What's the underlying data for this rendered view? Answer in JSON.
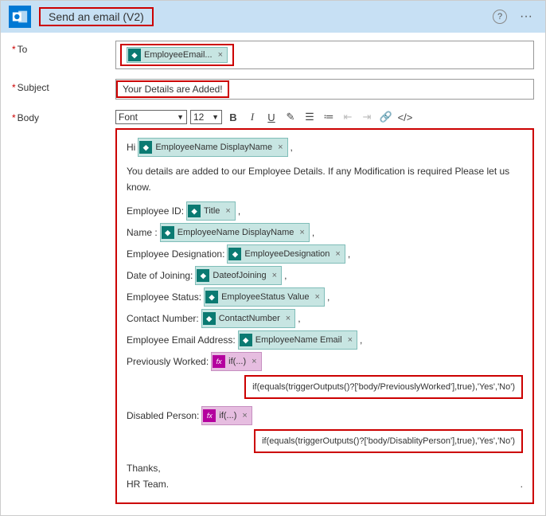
{
  "header": {
    "title": "Send an email (V2)"
  },
  "fields": {
    "to_label": "To",
    "subject_label": "Subject",
    "body_label": "Body",
    "subject_value": "Your Details are Added!"
  },
  "tokens": {
    "employee_email": "EmployeeEmail...",
    "employee_name_display": "EmployeeName DisplayName",
    "title": "Title",
    "employee_designation": "EmployeeDesignation",
    "date_of_joining": "DateofJoining",
    "employee_status_value": "EmployeeStatus Value",
    "contact_number": "ContactNumber",
    "employee_name_email": "EmployeeName Email",
    "if_short": "if(...)"
  },
  "toolbar": {
    "font": "Font",
    "size": "12"
  },
  "body": {
    "greeting": "Hi",
    "para1": "You details are added to our Employee Details. If any Modification is required Please let us know.",
    "l_empid": "Employee ID:",
    "l_name": "Name :",
    "l_desig": "Employee Designation:",
    "l_doj": "Date of Joining:",
    "l_status": "Employee Status:",
    "l_contact": "Contact Number:",
    "l_email": "Employee Email Address:",
    "l_prev": "Previously Worked:",
    "l_disabled": "Disabled Person:",
    "expr_prev": "if(equals(triggerOutputs()?['body/PreviouslyWorked'],true),'Yes','No')",
    "expr_disabled": "if(equals(triggerOutputs()?['body/DisablityPerson'],true),'Yes','No')",
    "thanks": "Thanks,",
    "team": "HR Team.",
    "comma": ",",
    "period": "."
  }
}
